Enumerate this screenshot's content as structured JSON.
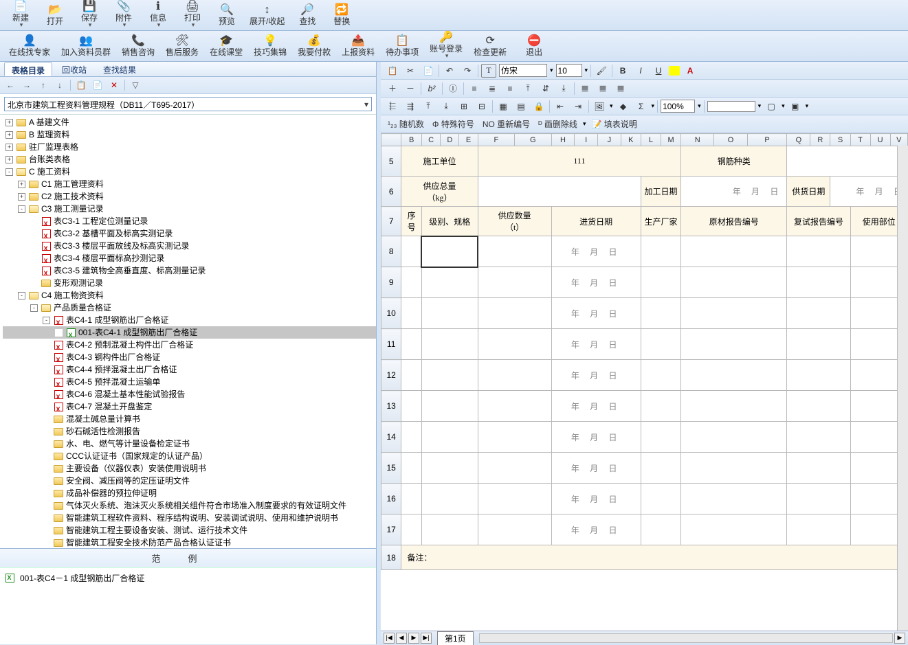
{
  "toolbar1": [
    {
      "label": "新建",
      "icon": "📄",
      "drop": true
    },
    {
      "label": "打开",
      "icon": "📂"
    },
    {
      "label": "保存",
      "icon": "💾",
      "drop": true
    },
    {
      "label": "附件",
      "icon": "📎",
      "drop": true
    },
    {
      "label": "信息",
      "icon": "ℹ",
      "drop": true
    },
    {
      "label": "打印",
      "icon": "🖨",
      "drop": true
    },
    {
      "label": "预览",
      "icon": "🔍"
    },
    {
      "label": "展开/收起",
      "icon": "↕"
    },
    {
      "label": "查找",
      "icon": "🔎"
    },
    {
      "label": "替换",
      "icon": "🔁"
    }
  ],
  "toolbar2": [
    {
      "label": "在线找专家",
      "icon": "👤"
    },
    {
      "label": "加入资料员群",
      "icon": "👥"
    },
    {
      "label": "销售咨询",
      "icon": "📞"
    },
    {
      "label": "售后服务",
      "icon": "🛠"
    },
    {
      "label": "在线课堂",
      "icon": "🎓"
    },
    {
      "label": "技巧集锦",
      "icon": "💡"
    },
    {
      "label": "我要付款",
      "icon": "💰"
    },
    {
      "label": "上报资料",
      "icon": "📤"
    },
    {
      "label": "待办事项",
      "icon": "📋"
    },
    {
      "label": "账号登录",
      "icon": "🔑",
      "drop": true
    },
    {
      "label": "检查更新",
      "icon": "⟳"
    },
    {
      "label": "退出",
      "icon": "⛔"
    }
  ],
  "panel_tabs": [
    "表格目录",
    "回收站",
    "查找结果"
  ],
  "combo_text": "北京市建筑工程资料管理规程（DB11／T695-2017）",
  "tree": [
    {
      "d": 0,
      "e": "+",
      "i": "fc",
      "t": "A 基建文件"
    },
    {
      "d": 0,
      "e": "+",
      "i": "fc",
      "t": "B 监理资料"
    },
    {
      "d": 0,
      "e": "+",
      "i": "fc",
      "t": "驻厂监理表格"
    },
    {
      "d": 0,
      "e": "+",
      "i": "fc",
      "t": "台账类表格"
    },
    {
      "d": 0,
      "e": "-",
      "i": "fo",
      "t": "C 施工资料"
    },
    {
      "d": 1,
      "e": "+",
      "i": "fc",
      "t": "C1 施工管理资料"
    },
    {
      "d": 1,
      "e": "+",
      "i": "fc",
      "t": "C2 施工技术资料"
    },
    {
      "d": 1,
      "e": "-",
      "i": "fo",
      "t": "C3 施工测量记录"
    },
    {
      "d": 2,
      "e": " ",
      "i": "red",
      "t": "表C3-1 工程定位测量记录"
    },
    {
      "d": 2,
      "e": " ",
      "i": "red",
      "t": "表C3-2 基槽平面及标高实测记录"
    },
    {
      "d": 2,
      "e": " ",
      "i": "red",
      "t": "表C3-3 楼层平面放线及标高实测记录"
    },
    {
      "d": 2,
      "e": " ",
      "i": "red",
      "t": "表C3-4 楼层平面标高抄测记录"
    },
    {
      "d": 2,
      "e": " ",
      "i": "red",
      "t": "表C3-5 建筑物全高垂直度、标高测量记录"
    },
    {
      "d": 2,
      "e": " ",
      "i": "fc",
      "t": "变形观测记录"
    },
    {
      "d": 1,
      "e": "-",
      "i": "fo",
      "t": "C4 施工物资资料"
    },
    {
      "d": 2,
      "e": "-",
      "i": "fo",
      "t": "产品质量合格证"
    },
    {
      "d": 3,
      "e": "-",
      "i": "red",
      "t": "表C4-1 成型钢筋出厂合格证"
    },
    {
      "d": 4,
      "e": " ",
      "i": "xls",
      "t": "001-表C4-1 成型钢筋出厂合格证",
      "sel": true
    },
    {
      "d": 3,
      "e": " ",
      "i": "red",
      "t": "表C4-2 预制混凝土构件出厂合格证"
    },
    {
      "d": 3,
      "e": " ",
      "i": "red",
      "t": "表C4-3 钢构件出厂合格证"
    },
    {
      "d": 3,
      "e": " ",
      "i": "red",
      "t": "表C4-4 预拌混凝土出厂合格证"
    },
    {
      "d": 3,
      "e": " ",
      "i": "red",
      "t": "表C4-5 预拌混凝土运输单"
    },
    {
      "d": 3,
      "e": " ",
      "i": "red",
      "t": "表C4-6 混凝土基本性能试验报告"
    },
    {
      "d": 3,
      "e": " ",
      "i": "red",
      "t": "表C4-7 混凝土开盘鉴定"
    },
    {
      "d": 3,
      "e": " ",
      "i": "fc",
      "t": "混凝土碱总量计算书"
    },
    {
      "d": 3,
      "e": " ",
      "i": "fc",
      "t": "砂石碱活性检测报告"
    },
    {
      "d": 3,
      "e": " ",
      "i": "fc",
      "t": "水、电、燃气等计量设备检定证书"
    },
    {
      "d": 3,
      "e": " ",
      "i": "fc",
      "t": "CCC认证证书（国家规定的认证产品）"
    },
    {
      "d": 3,
      "e": " ",
      "i": "fc",
      "t": "主要设备（仪器仪表）安装使用说明书"
    },
    {
      "d": 3,
      "e": " ",
      "i": "fc",
      "t": "安全阀、减压阀等的定压证明文件"
    },
    {
      "d": 3,
      "e": " ",
      "i": "fc",
      "t": "成品补偿器的预拉伸证明"
    },
    {
      "d": 3,
      "e": " ",
      "i": "fc",
      "t": "气体灭火系统、泡沫灭火系统相关组件符合市场准入制度要求的有效证明文件"
    },
    {
      "d": 3,
      "e": " ",
      "i": "fc",
      "t": "智能建筑工程软件资料、程序结构说明、安装调试说明、使用和维护说明书"
    },
    {
      "d": 3,
      "e": " ",
      "i": "fc",
      "t": "智能建筑工程主要设备安装、测试、运行技术文件"
    },
    {
      "d": 3,
      "e": " ",
      "i": "fc",
      "t": "智能建筑工程安全技术防范产品合格认证证书"
    }
  ],
  "example_title": "范例",
  "example_item": "001-表C4－1 成型钢筋出厂合格证",
  "editor": {
    "font": "仿宋",
    "size": "10",
    "zoom": "100%",
    "row4": [
      "随机数",
      "特殊符号",
      "重新编号",
      "画删除线",
      "填表说明"
    ]
  },
  "sheet": {
    "cols": [
      "B",
      "C",
      "D",
      "E",
      "F",
      "G",
      "H",
      "I",
      "J",
      "K",
      "L",
      "M",
      "N",
      "O",
      "P",
      "Q",
      "R",
      "S",
      "T",
      "U",
      "V"
    ],
    "row5": {
      "l1": "施工单位",
      "v1": "111",
      "l2": "钢筋种类"
    },
    "row6": {
      "l1": "供应总量\n（kg）",
      "l2": "加工日期",
      "v2": "年  月  日",
      "l3": "供货日期",
      "v3": "年  月  日"
    },
    "row7": [
      "序号",
      "级别、规格",
      "供应数量\n（t）",
      "进货日期",
      "生产厂家",
      "原材报告编号",
      "复试报告编号",
      "使用部位"
    ],
    "ymd": "年  月  日",
    "row18": "备注：",
    "page_tab": "第1页"
  }
}
